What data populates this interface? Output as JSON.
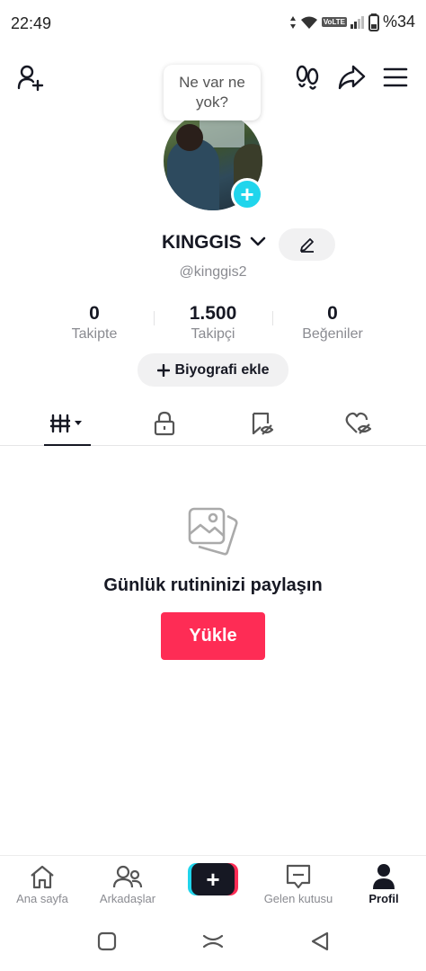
{
  "status_bar": {
    "time": "22:49",
    "network_badge": "VoLTE",
    "battery": "%34"
  },
  "top_bar": {
    "icons": [
      "add-friend-icon",
      "footprints-icon",
      "share-icon",
      "menu-icon"
    ]
  },
  "note_bubble": {
    "text": "Ne var ne yok?"
  },
  "profile": {
    "username": "KINGGIS",
    "handle": "@kinggis2",
    "stats": [
      {
        "value": "0",
        "label": "Takipte"
      },
      {
        "value": "1.500",
        "label": "Takipçi"
      },
      {
        "value": "0",
        "label": "Beğeniler"
      }
    ],
    "bio_button": "Biyografi ekle"
  },
  "tabs": [
    {
      "name": "videos",
      "icon": "grid-icon",
      "selected": true
    },
    {
      "name": "private",
      "icon": "lock-icon",
      "selected": false
    },
    {
      "name": "favorites",
      "icon": "bookmark-hidden-icon",
      "selected": false
    },
    {
      "name": "liked",
      "icon": "heart-hidden-icon",
      "selected": false
    }
  ],
  "empty_state": {
    "title": "Günlük rutininizi paylaşın",
    "button": "Yükle"
  },
  "bottom_nav": [
    {
      "label": "Ana sayfa",
      "icon": "home-icon"
    },
    {
      "label": "Arkadaşlar",
      "icon": "friends-icon"
    },
    {
      "label": "",
      "icon": "create-icon"
    },
    {
      "label": "Gelen kutusu",
      "icon": "inbox-icon"
    },
    {
      "label": "Profil",
      "icon": "profile-icon",
      "active": true
    }
  ],
  "colors": {
    "accent": "#fe2c55",
    "cyan": "#20d5ec",
    "text": "#161823",
    "muted": "#8a8b91"
  }
}
